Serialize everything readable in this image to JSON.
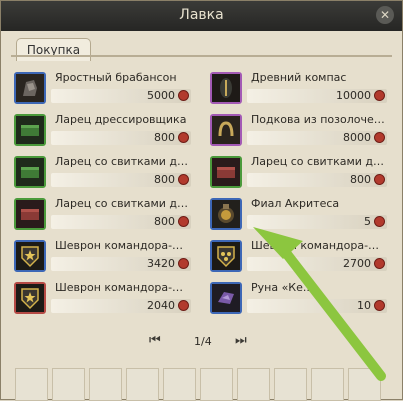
{
  "window": {
    "title": "Лавка",
    "close_icon": "close-icon"
  },
  "tabs": [
    {
      "label": "Покупка"
    }
  ],
  "items": [
    {
      "name": "Яростный брабансон",
      "price": "5000",
      "icon": "dog-armor-icon",
      "rarity_color": "#3d67b6"
    },
    {
      "name": "Древний компас",
      "price": "10000",
      "icon": "compass-icon",
      "rarity_color": "#a35ab5"
    },
    {
      "name": "Ларец дрессировщика",
      "price": "800",
      "icon": "green-chest-icon",
      "rarity_color": "#4b9a3b"
    },
    {
      "name": "Подкова из позолоченной с..",
      "price": "8000",
      "icon": "horseshoe-icon",
      "rarity_color": "#a35ab5"
    },
    {
      "name": "Ларец со свитками дрессир..",
      "price": "800",
      "icon": "green-chest-icon",
      "rarity_color": "#4b9a3b"
    },
    {
      "name": "Ларец со свитками дрессир..",
      "price": "800",
      "icon": "red-chest-icon",
      "rarity_color": "#4b9a3b"
    },
    {
      "name": "Ларец со свитками дрессир..",
      "price": "800",
      "icon": "red-chest-icon",
      "rarity_color": "#4b9a3b"
    },
    {
      "name": "Фиал Акритеса",
      "price": "5",
      "icon": "vial-icon",
      "rarity_color": "#3d67b6"
    },
    {
      "name": "Шеврон командора-протек..",
      "price": "3420",
      "icon": "chevron-protector-icon",
      "rarity_color": "#3d67b6"
    },
    {
      "name": "Шеврон командора-капитана",
      "price": "2700",
      "icon": "chevron-captain-icon",
      "rarity_color": "#3d67b6"
    },
    {
      "name": "Шеврон командора-лейтен..",
      "price": "2040",
      "icon": "chevron-lieutenant-icon",
      "rarity_color": "#b54a45"
    },
    {
      "name": "Руна «Ке..»",
      "price": "10",
      "icon": "rune-icon",
      "rarity_color": "#3d67b6"
    }
  ],
  "pager": {
    "page": "1/4",
    "first_icon": "first-page-icon",
    "last_icon": "last-page-icon"
  },
  "accent": "#8cc63f"
}
